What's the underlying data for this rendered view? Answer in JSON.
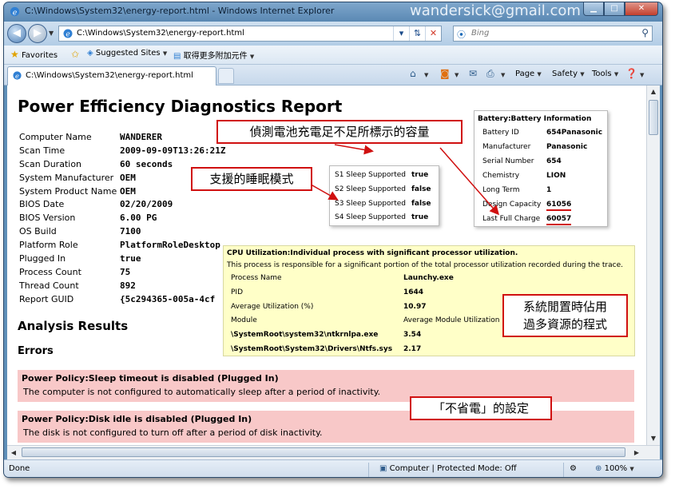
{
  "window": {
    "title": "C:\\Windows\\System32\\energy-report.html - Windows Internet Explorer",
    "watermark": "wandersick@gmail.com"
  },
  "address_bar": {
    "url": "C:\\Windows\\System32\\energy-report.html",
    "search_placeholder": "Bing"
  },
  "favorites_bar": {
    "favorites_label": "Favorites",
    "suggested_sites_label": "Suggested Sites",
    "get_more_addons_label": "取得更多附加元件"
  },
  "tab": {
    "title": "C:\\Windows\\System32\\energy-report.html"
  },
  "command_bar": {
    "page_label": "Page",
    "safety_label": "Safety",
    "tools_label": "Tools"
  },
  "report": {
    "title": "Power Efficiency Diagnostics Report",
    "info": [
      {
        "label": "Computer Name",
        "value": "WANDERER"
      },
      {
        "label": "Scan Time",
        "value": "2009-09-09T13:26:21Z"
      },
      {
        "label": "Scan Duration",
        "value": "60 seconds"
      },
      {
        "label": "System Manufacturer",
        "value": "OEM"
      },
      {
        "label": "System Product Name",
        "value": "OEM"
      },
      {
        "label": "BIOS Date",
        "value": "02/20/2009"
      },
      {
        "label": "BIOS Version",
        "value": "6.00 PG"
      },
      {
        "label": "OS Build",
        "value": "7100"
      },
      {
        "label": "Platform Role",
        "value": "PlatformRoleDesktop"
      },
      {
        "label": "Plugged In",
        "value": "true"
      },
      {
        "label": "Process Count",
        "value": "75"
      },
      {
        "label": "Thread Count",
        "value": "892"
      },
      {
        "label": "Report GUID",
        "value": "{5c294365-005a-4cf"
      }
    ],
    "analysis_heading": "Analysis Results",
    "errors_heading": "Errors",
    "errors": [
      {
        "title": "Power Policy:Sleep timeout is disabled (Plugged In)",
        "description": "The computer is not configured to automatically sleep after a period of inactivity."
      },
      {
        "title": "Power Policy:Disk idle is disabled (Plugged In)",
        "description": "The disk is not configured to turn off after a period of disk inactivity."
      }
    ]
  },
  "sleep_popup": {
    "rows": [
      {
        "label": "S1 Sleep Supported",
        "value": "true"
      },
      {
        "label": "S2 Sleep Supported",
        "value": "false"
      },
      {
        "label": "S3 Sleep Supported",
        "value": "false"
      },
      {
        "label": "S4 Sleep Supported",
        "value": "true"
      }
    ]
  },
  "battery_popup": {
    "title": "Battery:Battery Information",
    "rows": [
      {
        "label": "Battery ID",
        "value": "654Panasonic"
      },
      {
        "label": "Manufacturer",
        "value": "Panasonic"
      },
      {
        "label": "Serial Number",
        "value": "654"
      },
      {
        "label": "Chemistry",
        "value": "LION"
      },
      {
        "label": "Long Term",
        "value": "1"
      },
      {
        "label": "Design Capacity",
        "value": "61056"
      },
      {
        "label": "Last Full Charge",
        "value": "60057"
      }
    ]
  },
  "cpu_popup": {
    "title": "CPU Utilization:Individual process with significant processor utilization.",
    "subtitle": "This process is responsible for a significant portion of the total processor utilization recorded during the trace.",
    "rows": [
      {
        "label": "Process Name",
        "value": "Launchy.exe"
      },
      {
        "label": "PID",
        "value": "1644"
      },
      {
        "label": "Average Utilization (%)",
        "value": "10.97"
      },
      {
        "label": "Module",
        "value": "Average Module Utilization"
      },
      {
        "label": "\\SystemRoot\\system32\\ntkrnlpa.exe",
        "value": "3.54"
      },
      {
        "label": "\\SystemRoot\\System32\\Drivers\\Ntfs.sys",
        "value": "2.17"
      }
    ]
  },
  "annotations": {
    "battery_note": "偵測電池充電足不足所標示的容量",
    "sleep_note": "支援的睡眠模式",
    "cpu_note_line1": "系統閒置時佔用",
    "cpu_note_line2": "過多資源的程式",
    "power_note": "「不省電」的設定"
  },
  "status_bar": {
    "status": "Done",
    "zone": "Computer | Protected Mode: Off",
    "zoom": "100%"
  },
  "colors": {
    "error_background": "#f8c8c8",
    "cpu_background": "#ffffc8",
    "annotation_red": "#d01010"
  }
}
